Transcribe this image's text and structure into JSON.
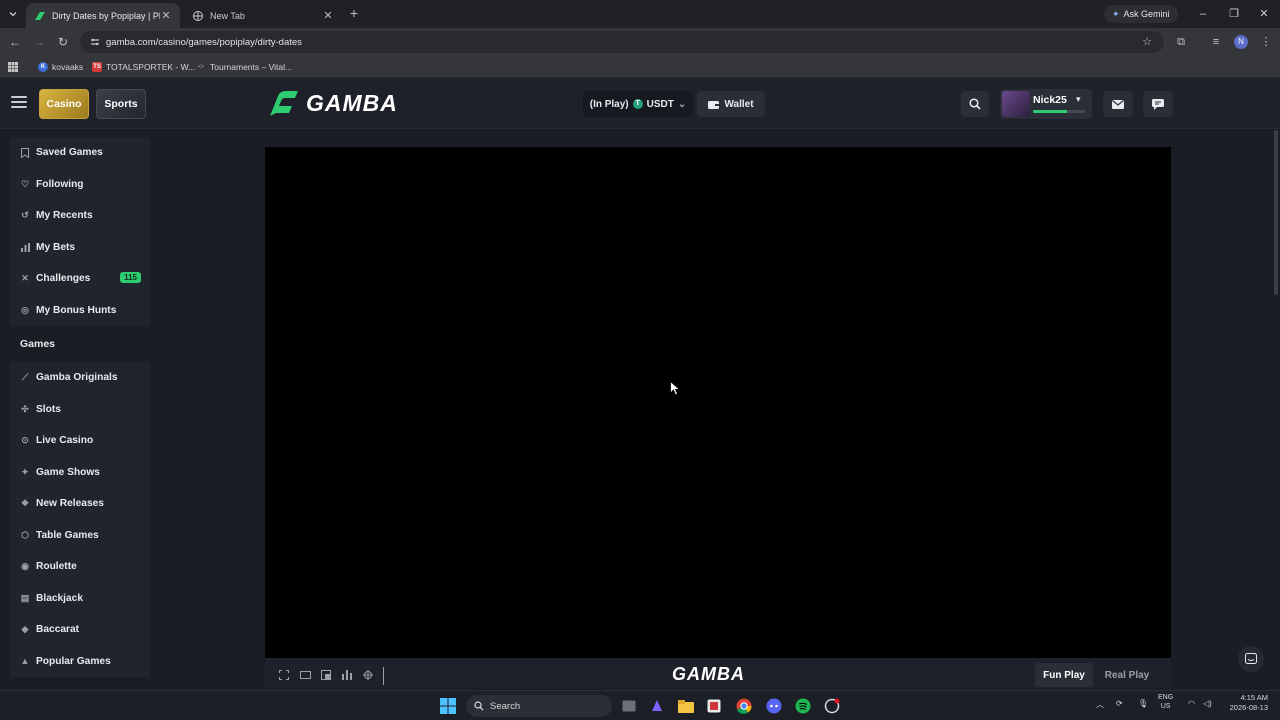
{
  "browser": {
    "tabs": [
      {
        "title": "Dirty Dates by Popiplay | Play O",
        "active": true
      },
      {
        "title": "New Tab",
        "active": false
      }
    ],
    "ask_gemini": "Ask Gemini",
    "url": "gamba.com/casino/games/popiplay/dirty-dates",
    "profile_initial": "N",
    "bookmarks": [
      {
        "label": "kovaaks",
        "icon": "bookmark-k-icon"
      },
      {
        "label": "TOTALSPORTEK - W...",
        "icon": "ts-icon"
      },
      {
        "label": "Tournaments – Vital...",
        "icon": "vital-icon"
      }
    ]
  },
  "header": {
    "casino": "Casino",
    "sports": "Sports",
    "logo_text": "GAMBA",
    "balance_label": "(In Play)",
    "currency": "USDT",
    "wallet": "Wallet",
    "username": "Nick25",
    "xp_progress": 0.65,
    "accent_color": "#2ecc71"
  },
  "sidebar": {
    "top_items": [
      {
        "label": "Saved Games",
        "icon": "bookmark-icon"
      },
      {
        "label": "Following",
        "icon": "heart-icon"
      },
      {
        "label": "My Recents",
        "icon": "history-icon"
      },
      {
        "label": "My Bets",
        "icon": "bar-chart-icon"
      },
      {
        "label": "Challenges",
        "icon": "crossed-swords-icon",
        "badge": "115"
      },
      {
        "label": "My Bonus Hunts",
        "icon": "target-icon"
      }
    ],
    "games_heading": "Games",
    "game_items": [
      {
        "label": "Gamba Originals",
        "icon": "gamba-icon"
      },
      {
        "label": "Slots",
        "icon": "slots-icon"
      },
      {
        "label": "Live Casino",
        "icon": "live-icon"
      },
      {
        "label": "Game Shows",
        "icon": "game-shows-icon"
      },
      {
        "label": "New Releases",
        "icon": "new-icon"
      },
      {
        "label": "Table Games",
        "icon": "table-icon"
      },
      {
        "label": "Roulette",
        "icon": "roulette-icon"
      },
      {
        "label": "Blackjack",
        "icon": "cards-icon"
      },
      {
        "label": "Baccarat",
        "icon": "baccarat-icon"
      },
      {
        "label": "Popular Games",
        "icon": "fire-icon"
      }
    ]
  },
  "game_bar": {
    "logo_text": "GAMBA",
    "fun_play": "Fun Play",
    "real_play": "Real Play"
  },
  "taskbar": {
    "search": "Search",
    "lang_top": "ENG",
    "lang_bottom": "US",
    "time": "4:15 AM",
    "date": "2026-08-13"
  }
}
